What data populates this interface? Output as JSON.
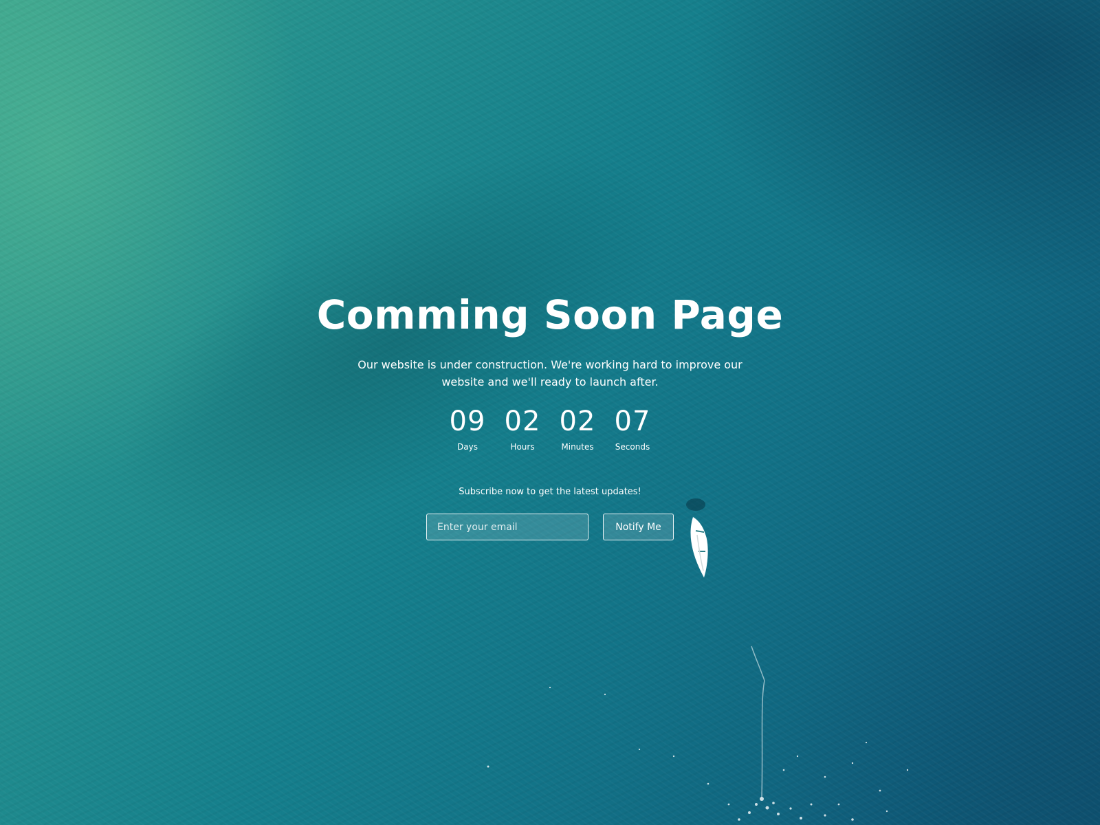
{
  "hero": {
    "title": "Comming Soon Page",
    "subtitle": "Our website is under construction. We're working hard to improve our website and we'll ready to launch after."
  },
  "countdown": {
    "days": {
      "value": "09",
      "label": "Days"
    },
    "hours": {
      "value": "02",
      "label": "Hours"
    },
    "minutes": {
      "value": "02",
      "label": "Minutes"
    },
    "seconds": {
      "value": "07",
      "label": "Seconds"
    }
  },
  "subscribe": {
    "text": "Subscribe now to get the latest updates!",
    "email_placeholder": "Enter your email",
    "email_value": "",
    "button_label": "Notify Me"
  },
  "colors": {
    "text": "#ffffff",
    "water_light": "#3aa38e",
    "water_dark": "#0c4f6e"
  }
}
